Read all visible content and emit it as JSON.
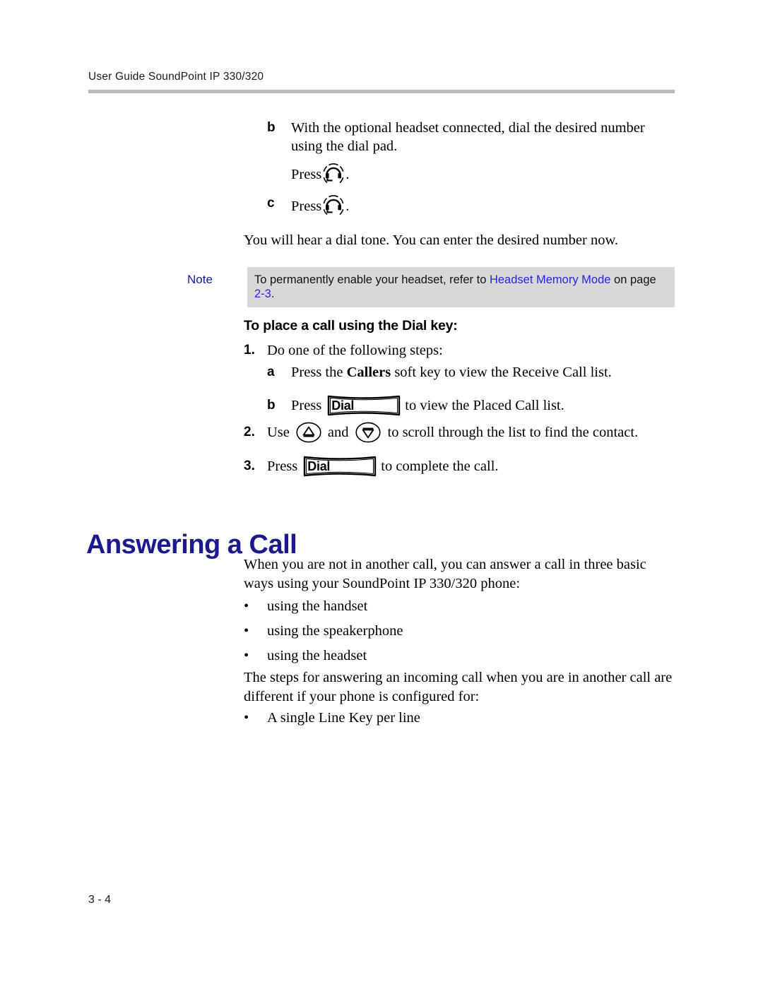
{
  "header": {
    "text": "User Guide SoundPoint IP 330/320"
  },
  "content": {
    "item_b_marker": "b",
    "item_b_text": "With the optional headset connected, dial the desired number using the dial pad.",
    "press_label_1": "Press",
    "press_period_1": ".",
    "item_c_marker": "c",
    "press_label_2": "Press",
    "press_period_2": ".",
    "dial_tone_text": "You will hear a dial tone. You can enter the desired number now."
  },
  "note": {
    "label": "Note",
    "text_before_link": "To permanently enable your headset, refer to ",
    "link_text": "Headset Memory Mode",
    "text_middle": " on page ",
    "page_link": "2-3",
    "text_after": "."
  },
  "procedure": {
    "heading": "To place a call using the Dial key:",
    "step1_num": "1.",
    "step1_text": "Do one of the following steps:",
    "step1a_marker": "a",
    "step1a_text_before": "Press the ",
    "step1a_bold": "Callers",
    "step1a_text_after": " soft key to view the Receive Call list.",
    "step1b_marker": "b",
    "step1b_press": "Press",
    "step1b_key_label": "Dial",
    "step1b_after": "to view the Placed Call list.",
    "step2_num": "2.",
    "step2_use": "Use",
    "step2_and": "and",
    "step2_after": "to scroll through the list to find the contact.",
    "step3_num": "3.",
    "step3_press": "Press",
    "step3_key_label": "Dial",
    "step3_after": "to complete the call."
  },
  "section": {
    "heading": "Answering a Call",
    "intro_paragraph": "When you are not in another call, you can answer a call in three basic ways using your SoundPoint IP 330/320 phone:",
    "ways": [
      "using the handset",
      "using the speakerphone",
      "using the headset"
    ],
    "second_paragraph": "The steps for answering an incoming call when you are in another call are different if your phone is configured for:",
    "config_items": [
      "A single Line Key per line"
    ],
    "bullet_glyph": "•"
  },
  "footer": {
    "page_number": "3 - 4"
  },
  "colors": {
    "heading_blue": "#1a1a8e",
    "link_blue": "#2424e0",
    "note_bg": "#d8d8d8",
    "rule_gray": "#bcbcbc"
  }
}
